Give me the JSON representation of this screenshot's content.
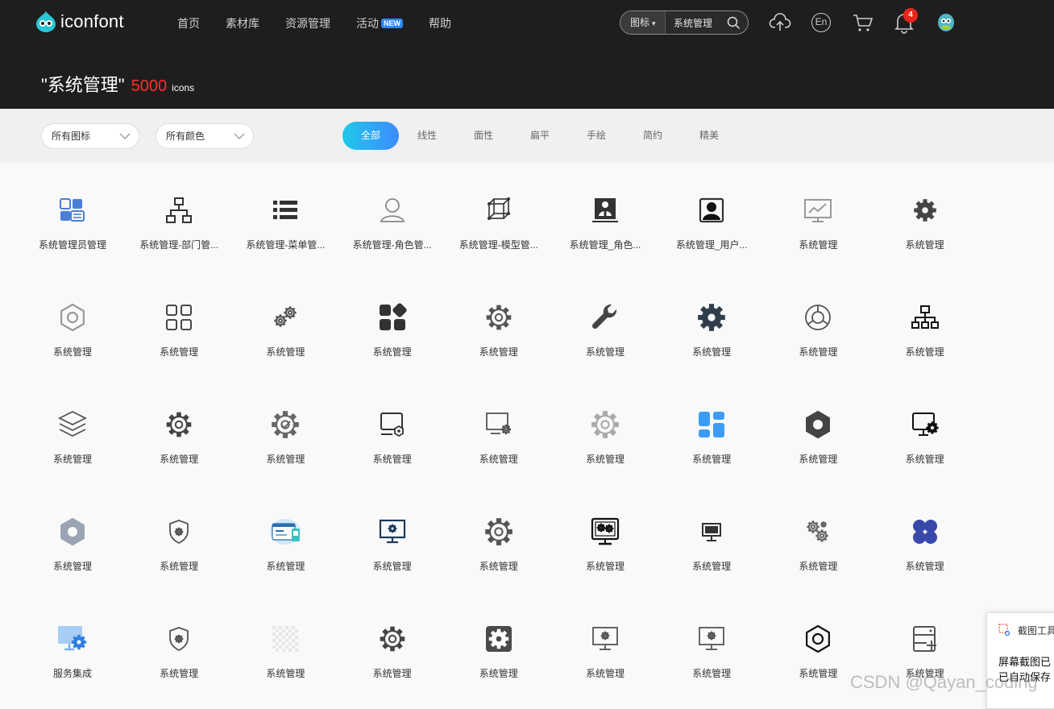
{
  "header": {
    "logo_text": "iconfont",
    "nav": [
      "首页",
      "素材库",
      "资源管理",
      "活动",
      "帮助"
    ],
    "new_badge": "NEW",
    "search_type": "图标",
    "search_value": "系统管理",
    "notification_count": "4",
    "lang_label": "En"
  },
  "result": {
    "query": "\"系统管理\"",
    "count": "5000",
    "unit": "icons"
  },
  "filters": {
    "icon_select": "所有图标",
    "color_select": "所有颜色",
    "tabs": [
      "全部",
      "线性",
      "面性",
      "扁平",
      "手绘",
      "简约",
      "精美"
    ],
    "active_tab": "全部"
  },
  "icons": [
    {
      "name": "系统管理员管理",
      "icon": "admin-panel-icon"
    },
    {
      "name": "系统管理-部门管...",
      "icon": "org-chart-icon"
    },
    {
      "name": "系统管理-菜单管...",
      "icon": "list-menu-icon"
    },
    {
      "name": "系统管理-角色管...",
      "icon": "user-outline-icon"
    },
    {
      "name": "系统管理-模型管...",
      "icon": "cube-model-icon"
    },
    {
      "name": "系统管理_角色...",
      "icon": "id-card-icon"
    },
    {
      "name": "系统管理_用户...",
      "icon": "user-frame-icon"
    },
    {
      "name": "系统管理",
      "icon": "monitor-chart-icon"
    },
    {
      "name": "系统管理",
      "icon": "gear-icon"
    },
    {
      "name": "系统管理",
      "icon": "hexagon-nut-icon"
    },
    {
      "name": "系统管理",
      "icon": "grid-squares-icon"
    },
    {
      "name": "系统管理",
      "icon": "double-gear-icon"
    },
    {
      "name": "系统管理",
      "icon": "apps-solid-icon"
    },
    {
      "name": "系统管理",
      "icon": "gear-ring-icon"
    },
    {
      "name": "系统管理",
      "icon": "wrench-icon"
    },
    {
      "name": "系统管理",
      "icon": "gear-solid-icon"
    },
    {
      "name": "系统管理",
      "icon": "pie-gauge-icon"
    },
    {
      "name": "系统管理",
      "icon": "network-tree-icon"
    },
    {
      "name": "系统管理",
      "icon": "layers-icon"
    },
    {
      "name": "系统管理",
      "icon": "gear-outline-icon"
    },
    {
      "name": "系统管理",
      "icon": "gear-check-icon"
    },
    {
      "name": "系统管理",
      "icon": "screen-hex-icon"
    },
    {
      "name": "系统管理",
      "icon": "screen-gear-icon"
    },
    {
      "name": "系统管理",
      "icon": "gear-thin-icon"
    },
    {
      "name": "系统管理",
      "icon": "blue-tiles-icon"
    },
    {
      "name": "系统管理",
      "icon": "gear-dark-icon"
    },
    {
      "name": "系统管理",
      "icon": "monitor-gear-icon"
    },
    {
      "name": "系统管理",
      "icon": "hexagon-solid-icon"
    },
    {
      "name": "系统管理",
      "icon": "shield-gear-icon"
    },
    {
      "name": "系统管理",
      "icon": "dashboard-illustration-icon"
    },
    {
      "name": "系统管理",
      "icon": "monitor-settings-icon"
    },
    {
      "name": "系统管理",
      "icon": "gear-large-icon"
    },
    {
      "name": "系统管理",
      "icon": "screen-gears-icon"
    },
    {
      "name": "系统管理",
      "icon": "desktop-icon"
    },
    {
      "name": "系统管理",
      "icon": "gears-cluster-icon"
    },
    {
      "name": "系统管理",
      "icon": "flower-tiles-icon"
    },
    {
      "name": "服务集成",
      "icon": "monitor-blue-gear-icon"
    },
    {
      "name": "系统管理",
      "icon": "shield-gear-icon"
    },
    {
      "name": "系统管理",
      "icon": "transparent-placeholder-icon"
    },
    {
      "name": "系统管理",
      "icon": "gear-outline-icon"
    },
    {
      "name": "系统管理",
      "icon": "gear-box-icon"
    },
    {
      "name": "系统管理",
      "icon": "monitor-gear-outline-icon"
    },
    {
      "name": "系统管理",
      "icon": "monitor-gear-outline-icon"
    },
    {
      "name": "系统管理",
      "icon": "hexagon-ring-icon"
    },
    {
      "name": "系统管理",
      "icon": "server-plus-icon"
    }
  ],
  "toast": {
    "title": "截图工具",
    "line1": "屏幕截图已",
    "line2": "已自动保存"
  },
  "watermark": "CSDN @Qayan_coding",
  "colors": {
    "header_bg": "#1e1e1e",
    "accent_red": "#ff2e2e",
    "tab_gradient_start": "#1fc8e8",
    "tab_gradient_end": "#3d8bff",
    "icon_blue": "#3b9cf5",
    "icon_dark": "#333333"
  }
}
